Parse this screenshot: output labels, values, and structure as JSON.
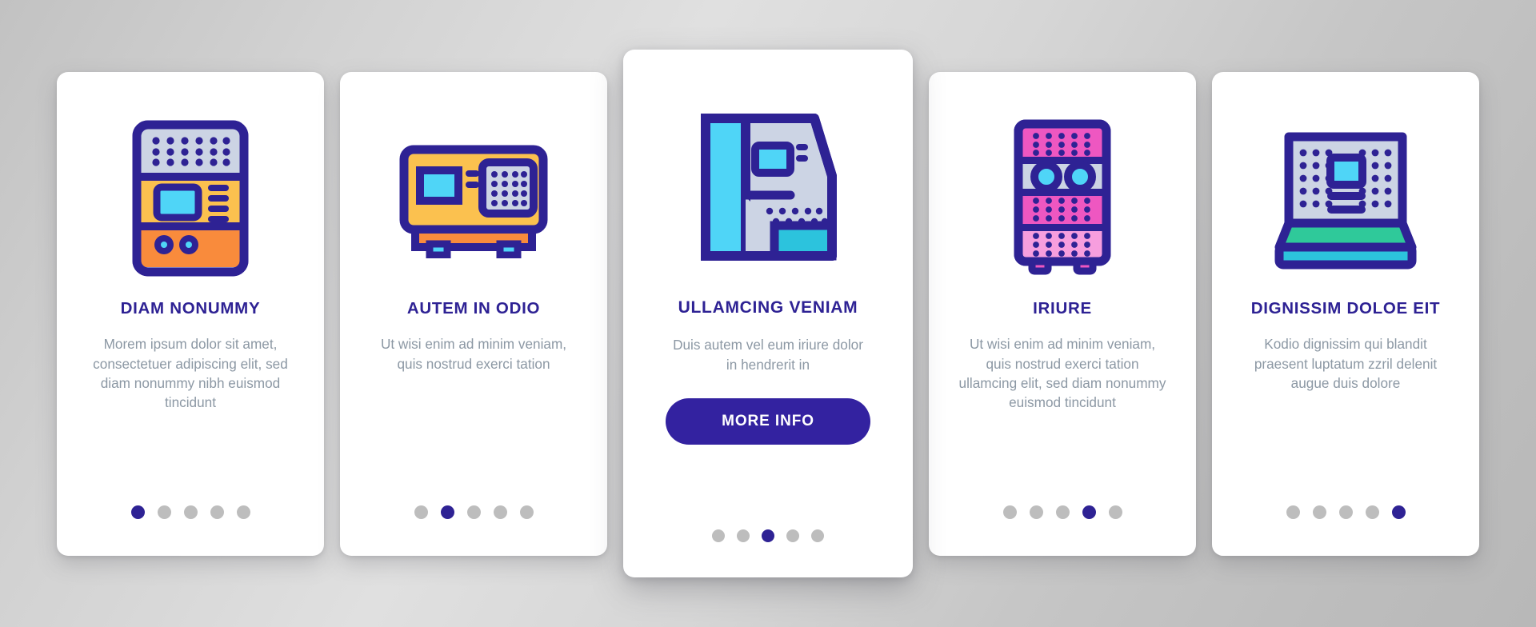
{
  "theme": {
    "page_background": "#c8c8c8",
    "card_background": "#ffffff",
    "title_color": "#2e2294",
    "body_text_color": "#8c98a4",
    "accent": "#3322a0",
    "dot_inactive": "#bdbdbd",
    "outline": "#2e2294",
    "yellow": "#fcc košice",
    "colors_used": [
      "#2e2294",
      "#fbc14f",
      "#f98b3c",
      "#4fd5f7",
      "#ccd4e4",
      "#2cc3dd",
      "#ee57c1",
      "#f79ede",
      "#2fc99a"
    ]
  },
  "cards": [
    {
      "id": "card-1",
      "icon_name": "vending-machine-icon",
      "title": "DIAM NONUMMY",
      "description": "Morem ipsum dolor sit amet, consectetuer adipiscing elit, sed diam nonummy nibh euismod tincidunt",
      "dots": {
        "count": 5,
        "active_index": 0
      },
      "has_cta": false,
      "cta_label": ""
    },
    {
      "id": "card-2",
      "icon_name": "payment-terminal-icon",
      "title": "AUTEM IN ODIO",
      "description": "Ut wisi enim ad minim veniam, quis nostrud exerci tation",
      "dots": {
        "count": 5,
        "active_index": 1
      },
      "has_cta": false,
      "cta_label": ""
    },
    {
      "id": "card-3",
      "icon_name": "arcade-machine-icon",
      "title": "ULLAMCING VENIAM",
      "description": "Duis autem vel eum iriure dolor in hendrerit in",
      "dots": {
        "count": 5,
        "active_index": 2
      },
      "has_cta": true,
      "cta_label": "MORE INFO"
    },
    {
      "id": "card-4",
      "icon_name": "server-cabinet-icon",
      "title": "IRIURE",
      "description": "Ut wisi enim ad minim veniam, quis nostrud exerci tation ullamcing elit, sed diam nonummy euismod tincidunt",
      "dots": {
        "count": 5,
        "active_index": 3
      },
      "has_cta": false,
      "cta_label": ""
    },
    {
      "id": "card-5",
      "icon_name": "kiosk-terminal-icon",
      "title": "DIGNISSIM DOLOE EIT",
      "description": "Kodio dignissim qui blandit praesent luptatum zzril delenit augue duis dolore",
      "dots": {
        "count": 5,
        "active_index": 4
      },
      "has_cta": false,
      "cta_label": ""
    }
  ]
}
